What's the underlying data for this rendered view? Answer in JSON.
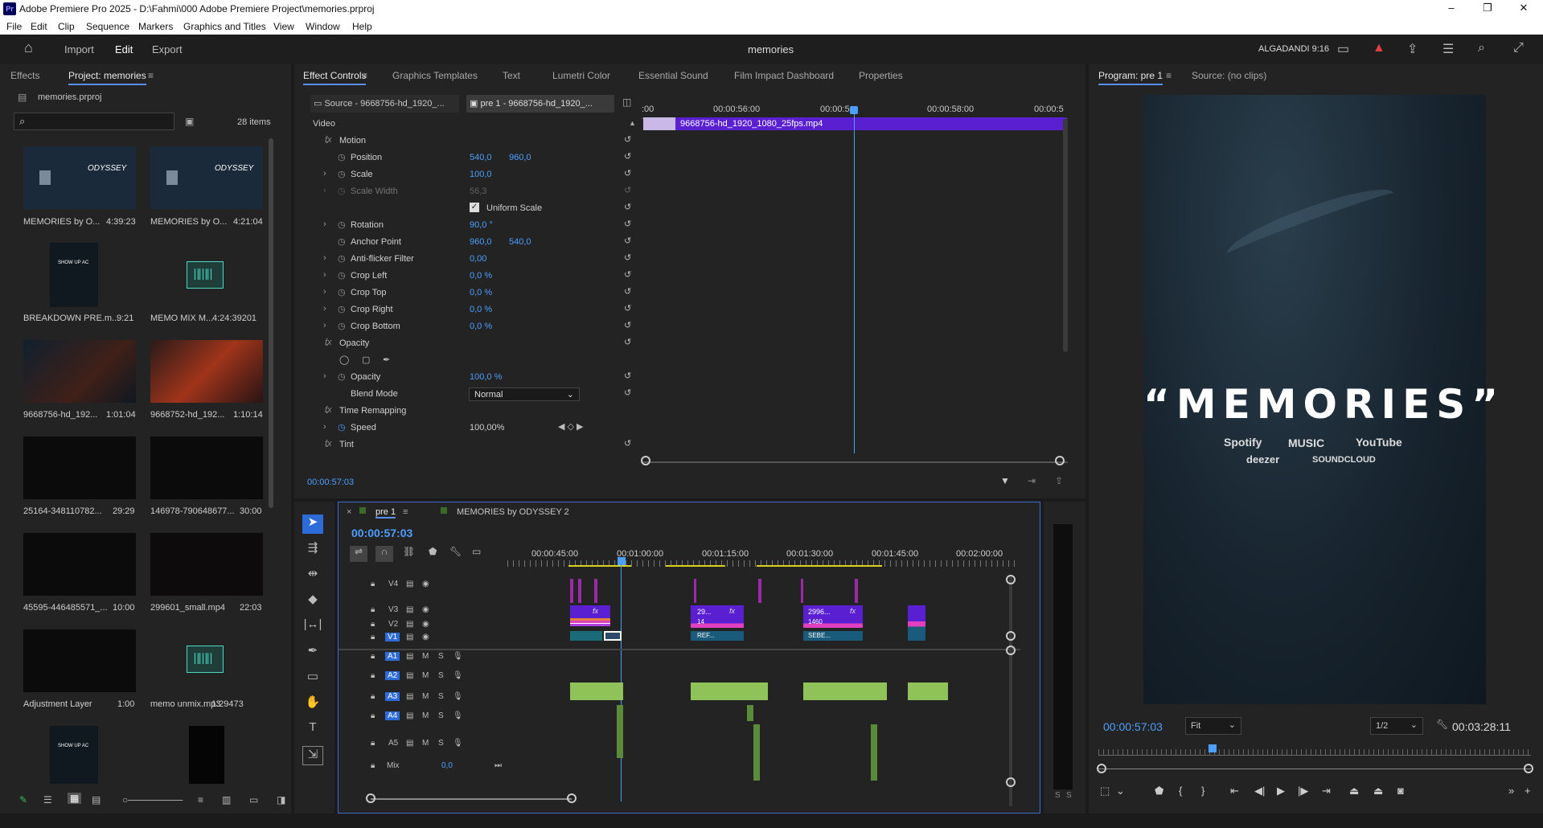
{
  "window": {
    "title": "Adobe Premiere Pro 2025 - D:\\Fahmi\\000 Adobe Premiere Project\\memories.prproj",
    "minimize": "–",
    "maximize": "❐",
    "close": "✕"
  },
  "menu": [
    "File",
    "Edit",
    "Clip",
    "Sequence",
    "Markers",
    "Graphics and Titles",
    "View",
    "Window",
    "Help"
  ],
  "header": {
    "home": "⌂",
    "import": "Import",
    "edit": "Edit",
    "export": "Export",
    "project_name": "memories",
    "user": "ALGADANDI 9:16"
  },
  "project": {
    "tab_effects": "Effects",
    "tab_project": "Project: memories",
    "file": "memories.prproj",
    "item_count": "28 items",
    "items": [
      {
        "name": "MEMORIES by O...",
        "dur": "4:39:23"
      },
      {
        "name": "MEMORIES by O...",
        "dur": "4:21:04"
      },
      {
        "name": "BREAKDOWN PRE.m...",
        "dur": "9:21"
      },
      {
        "name": "MEMO MIX M...",
        "dur": "4:24:39201"
      },
      {
        "name": "9668756-hd_192...",
        "dur": "1:01:04"
      },
      {
        "name": "9668752-hd_192...",
        "dur": "1:10:14"
      },
      {
        "name": "25164-348110782...",
        "dur": "29:29"
      },
      {
        "name": "146978-790648677...",
        "dur": "30:00"
      },
      {
        "name": "45595-446485571_...",
        "dur": "10:00"
      },
      {
        "name": "299601_small.mp4",
        "dur": "22:03"
      },
      {
        "name": "Adjustment Layer",
        "dur": "1:00"
      },
      {
        "name": "memo unmix.mp3",
        "dur": "1:29473"
      }
    ],
    "thumb_text_odyssey": "ODYSSEY",
    "thumb_text_show": "SHOW UP AC"
  },
  "center_tabs": [
    "Effect Controls",
    "Graphics Templates",
    "Text",
    "Lumetri Color",
    "Essential Sound",
    "Film Impact Dashboard",
    "Properties"
  ],
  "effect_controls": {
    "source": "Source - 9668756-hd_1920_...",
    "sequence": "pre 1 - 9668756-hd_1920_...",
    "video": "Video",
    "motion": "Motion",
    "rows": [
      {
        "name": "Position",
        "v1": "540,0",
        "v2": "960,0"
      },
      {
        "name": "Scale",
        "v1": "100,0",
        "v2": ""
      },
      {
        "name": "Scale Width",
        "v1": "56,3",
        "v2": ""
      },
      {
        "name": "Uniform Scale",
        "v1": "",
        "v2": ""
      },
      {
        "name": "Rotation",
        "v1": "90,0 °",
        "v2": ""
      },
      {
        "name": "Anchor Point",
        "v1": "960,0",
        "v2": "540,0"
      },
      {
        "name": "Anti-flicker Filter",
        "v1": "0,00",
        "v2": ""
      },
      {
        "name": "Crop Left",
        "v1": "0,0 %",
        "v2": ""
      },
      {
        "name": "Crop Top",
        "v1": "0,0 %",
        "v2": ""
      },
      {
        "name": "Crop Right",
        "v1": "0,0 %",
        "v2": ""
      },
      {
        "name": "Crop Bottom",
        "v1": "0,0 %",
        "v2": ""
      }
    ],
    "opacity_group": "Opacity",
    "opacity": "Opacity",
    "opacity_val": "100,0 %",
    "blend_mode": "Blend Mode",
    "blend_val": "Normal",
    "time_remap": "Time Remapping",
    "speed": "Speed",
    "speed_val": "100,00%",
    "tint": "Tint",
    "ruler": [
      ":00",
      "00:00:56:00",
      "00:00:5",
      "00:00:58:00",
      "00:00:5"
    ],
    "clip_name": "9668756-hd_1920_1080_25fps.mp4",
    "timecode": "00:00:57:03"
  },
  "program": {
    "tab": "Program: pre 1",
    "source": "Source: (no clips)",
    "title": "“MEMORIES”",
    "logos": [
      "Spotify",
      "MUSIC",
      "YouTube",
      "deezer",
      "SOUNDCLOUD"
    ],
    "timecode": "00:00:57:03",
    "fit": "Fit",
    "res": "1/2",
    "duration": "00:03:28:11"
  },
  "timeline": {
    "tab1": "pre 1",
    "tab2": "MEMORIES by ODYSSEY 2",
    "timecode": "00:00:57:03",
    "ruler": [
      "00:00:45:00",
      "00:01:00:00",
      "00:01:15:00",
      "00:01:30:00",
      "00:01:45:00",
      "00:02:00:00"
    ],
    "video_tracks": [
      "V4",
      "V3",
      "V2",
      "V1"
    ],
    "audio_tracks": [
      "A1",
      "A2",
      "A3",
      "A4",
      "A5"
    ],
    "mix": "Mix",
    "mix_val": "0,0",
    "m": "M",
    "s": "S",
    "clip_labels": [
      "29...",
      "14",
      "REF...",
      "2996...",
      "1460",
      "SEBE..."
    ]
  },
  "meters": {
    "s1": "S",
    "s2": "S"
  },
  "colors": {
    "accent": "#4d9fff",
    "clip_purple": "#6a2fd0",
    "clip_green": "#8fc35a",
    "clip_magenta": "#9a2aa8"
  }
}
